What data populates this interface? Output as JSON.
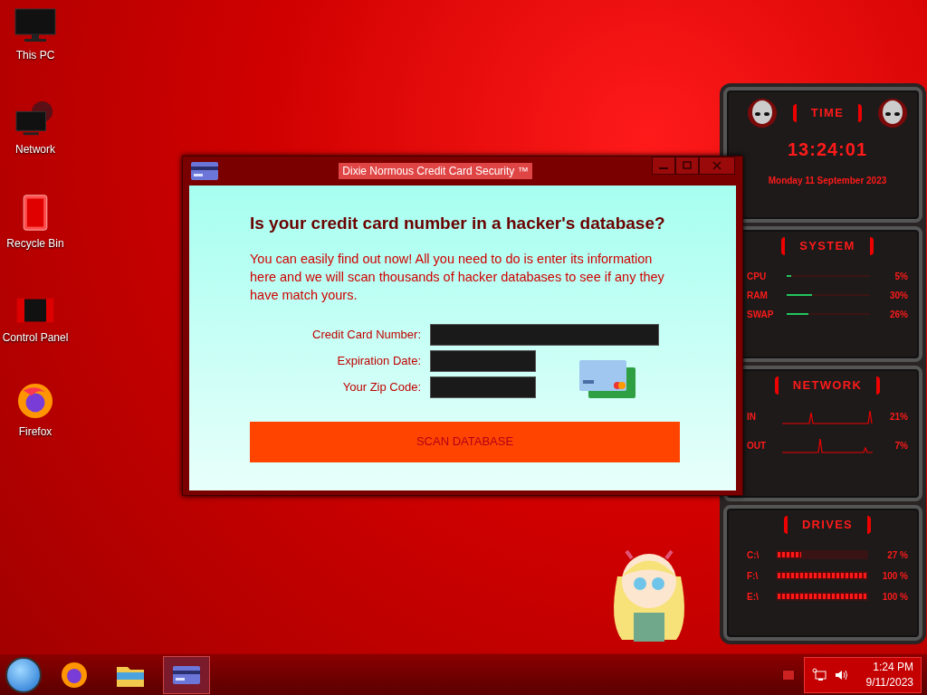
{
  "desktop_icons": [
    {
      "label": "This PC",
      "kind": "monitor"
    },
    {
      "label": "Network",
      "kind": "network"
    },
    {
      "label": "Recycle Bin",
      "kind": "bin"
    },
    {
      "label": "Control Panel",
      "kind": "panel"
    },
    {
      "label": "Firefox",
      "kind": "firefox"
    }
  ],
  "window": {
    "title": "Dixie Normous Credit Card Security ™",
    "heading": "Is your credit card number in a hacker's database?",
    "intro": "You can easily find out now! All you need to do is enter its information here and we will scan thousands of hacker databases to see if any they have match yours.",
    "fields": [
      {
        "label": "Credit Card Number:",
        "kind": "long"
      },
      {
        "label": "Expiration Date:",
        "kind": "short"
      },
      {
        "label": "Your Zip Code:",
        "kind": "short"
      }
    ],
    "button": "SCAN DATABASE"
  },
  "gadget": {
    "time": {
      "title": "TIME",
      "clock": "13:24:01",
      "date": "Monday 11 September 2023"
    },
    "system": {
      "title": "SYSTEM",
      "rows": [
        {
          "label": "CPU",
          "reading": "5%",
          "level": 0.05
        },
        {
          "label": "RAM",
          "reading": "30%",
          "level": 0.3
        },
        {
          "label": "SWAP",
          "reading": "26%",
          "level": 0.26
        }
      ]
    },
    "network": {
      "title": "NETWORK",
      "rows": [
        {
          "label": "IN",
          "reading": "21%"
        },
        {
          "label": "OUT",
          "reading": "7%"
        }
      ]
    },
    "drives": {
      "title": "DRIVES",
      "rows": [
        {
          "label": "C:\\",
          "reading": "27 %",
          "level": 0.27
        },
        {
          "label": "F:\\",
          "reading": "100 %",
          "level": 1
        },
        {
          "label": "E:\\",
          "reading": "100 %",
          "level": 1
        }
      ]
    }
  },
  "taskbar": {
    "apps": [
      {
        "kind": "firefox",
        "selected": false
      },
      {
        "kind": "explorer",
        "selected": false
      },
      {
        "kind": "card",
        "selected": true
      }
    ],
    "time": "1:24 PM",
    "date": "9/11/2023"
  }
}
